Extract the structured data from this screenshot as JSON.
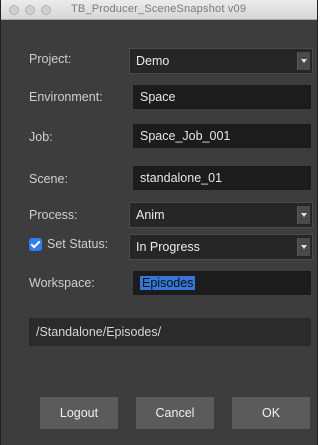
{
  "window": {
    "title": "TB_Producer_SceneSnapshot v09"
  },
  "form": {
    "project": {
      "label": "Project:",
      "value": "Demo"
    },
    "environment": {
      "label": "Environment:",
      "value": "Space"
    },
    "job": {
      "label": "Job:",
      "value": "Space_Job_001"
    },
    "scene": {
      "label": "Scene:",
      "value": "standalone_01"
    },
    "process": {
      "label": "Process:",
      "value": "Anim"
    },
    "set_status": {
      "label": "Set Status:",
      "checked": true,
      "value": "In Progress"
    },
    "workspace": {
      "label": "Workspace:",
      "value": "Episodes"
    }
  },
  "path": "/Standalone/Episodes/",
  "buttons": {
    "logout": "Logout",
    "cancel": "Cancel",
    "ok": "OK"
  },
  "colors": {
    "window_bg": "#3d3d3d",
    "field_bg": "#1c1c1c",
    "checkbox_accent": "#2f7cf6",
    "selection": "#3477d6",
    "button_bg": "#5b5b5b"
  },
  "icons": {
    "dropdown": "chevron-down-icon",
    "checkbox": "checkmark-icon"
  }
}
